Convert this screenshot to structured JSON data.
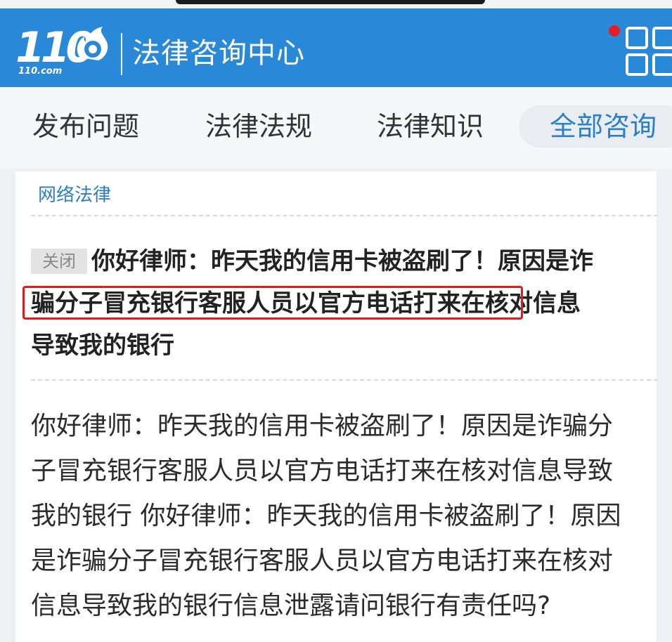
{
  "header": {
    "logo_digits": "110",
    "logo_domain": "110.com",
    "title": "法律咨询中心",
    "colors": {
      "bar": "#2a88d8",
      "notification": "#e41e25"
    },
    "icons": [
      "menu-grid-icon",
      "notification-dot"
    ]
  },
  "tabs": [
    {
      "label": "发布问题"
    },
    {
      "label": "法律法规"
    },
    {
      "label": "法律知识"
    },
    {
      "label": "全部咨询",
      "active": true
    }
  ],
  "question": {
    "category": "网络法律",
    "status_badge": "关闭",
    "title_lines": [
      "你好律师：昨天我的信用卡被盗刷了！原因是诈",
      "骗分子冒充银行客服人员以官方电话打来在核对信息",
      "导致我的银行"
    ],
    "highlighted_text": "骗分子冒充银行客服人员以官方电话打来",
    "highlight_color": "#e21b1b",
    "body_lines": [
      "你好律师：昨天我的信用卡被盗刷了！原因是诈骗分",
      "子冒充银行客服人员以官方电话打来在核对信息导致",
      "我的银行 你好律师：昨天我的信用卡被盗刷了！原因",
      "是诈骗分子冒充银行客服人员以官方电话打来在核对",
      "信息导致我的银行信息泄露请问银行有责任吗?"
    ]
  }
}
